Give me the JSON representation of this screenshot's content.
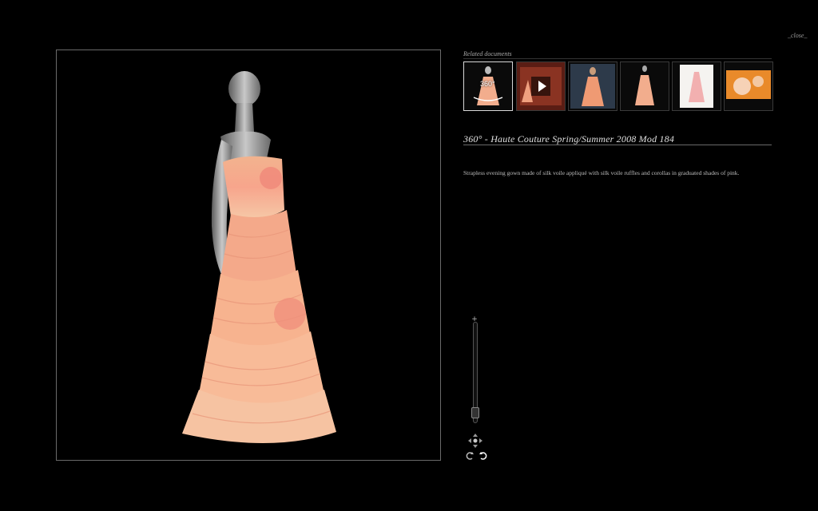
{
  "window": {
    "close_label": "_close_"
  },
  "viewer": {
    "image": "mannequin-evening-gown",
    "background": "#000000",
    "gown_color": "#f5b08a"
  },
  "related": {
    "label": "Related documents",
    "thumbnails": [
      {
        "name": "360-view",
        "overlay": "360°",
        "active": true
      },
      {
        "name": "video",
        "overlay": "play-icon",
        "active": false
      },
      {
        "name": "runway-photo",
        "overlay": "",
        "active": false
      },
      {
        "name": "mannequin-photo",
        "overlay": "",
        "active": false
      },
      {
        "name": "sketch",
        "overlay": "",
        "active": false
      },
      {
        "name": "detail-photo",
        "overlay": "",
        "active": false
      }
    ]
  },
  "document": {
    "title": "360° - Haute Couture Spring/Summer 2008 Mod 184",
    "description": "Strapless evening gown made of silk voile appliqué with silk voile ruffles and corollas in graduated shades of pink."
  },
  "controls": {
    "zoom_in_label": "+",
    "zoom_level": 0.05
  }
}
